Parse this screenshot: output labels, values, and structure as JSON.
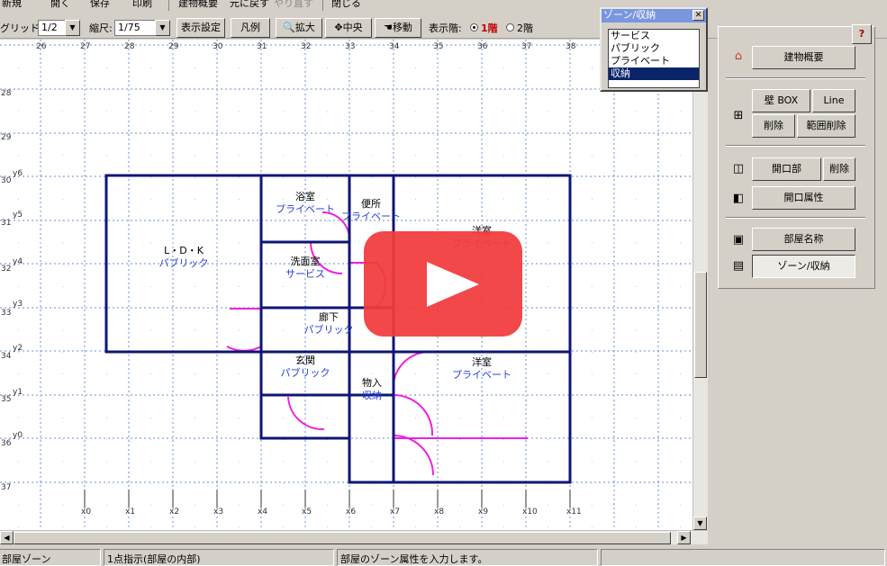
{
  "menu": [
    {
      "label": "新規",
      "disabled": false
    },
    {
      "label": "開く",
      "disabled": false
    },
    {
      "label": "保存",
      "disabled": false
    },
    {
      "label": "印刷",
      "disabled": false
    },
    {
      "label": "建物概要",
      "disabled": false
    },
    {
      "label": "元に戻す",
      "disabled": false
    },
    {
      "label": "やり直す",
      "disabled": true
    },
    {
      "label": "閉じる",
      "disabled": false
    }
  ],
  "toolbar": {
    "grid_label": "グリッド:",
    "grid_value": "1/2",
    "scale_label": "縮尺:",
    "scale_value": "1/75",
    "display_settings": "表示設定",
    "legend": "凡例",
    "zoom": "拡大",
    "center": "中央",
    "move": "移動",
    "floor_label": "表示階:",
    "floor1": "1階",
    "floor2": "2階",
    "floor_selected": "1階"
  },
  "zone_window": {
    "title": "ゾーン/収納",
    "close": "✕",
    "options": [
      "サービス",
      "パブリック",
      "プライベート",
      "収納"
    ],
    "selected": "収納"
  },
  "right_panel": {
    "help": "?",
    "building_overview": "建物概要",
    "wall_box": "壁 BOX",
    "line": "Line",
    "delete": "削除",
    "range_delete": "範囲削除",
    "opening": "開口部",
    "opening_delete": "削除",
    "opening_attr": "開口属性",
    "room_name": "部屋名称",
    "zone_storage": "ゾーン/収納"
  },
  "plan": {
    "top_axis": [
      "26",
      "27",
      "28",
      "29",
      "30",
      "31",
      "32",
      "33",
      "34",
      "35",
      "36",
      "37",
      "38"
    ],
    "left_axis": [
      "28",
      "29",
      "y6",
      "30",
      "y5",
      "31",
      "y4",
      "32",
      "y3",
      "33",
      "y2",
      "34",
      "y1",
      "35",
      "y0",
      "36",
      "37"
    ],
    "bottom_axis": [
      "x0",
      "x1",
      "x2",
      "x3",
      "x4",
      "x5",
      "x6",
      "x7",
      "x8",
      "x9",
      "x10",
      "x11"
    ],
    "rooms": [
      {
        "name": "浴室",
        "zone": "プライベート"
      },
      {
        "name": "便所",
        "zone": "プライベート"
      },
      {
        "name": "洋室",
        "zone": "プライベート"
      },
      {
        "name": "L・D・K",
        "zone": "パブリック"
      },
      {
        "name": "洗面室",
        "zone": "サービス"
      },
      {
        "name": "廊下",
        "zone": "パブリック"
      },
      {
        "name": "玄関",
        "zone": "パブリック"
      },
      {
        "name": "物入",
        "zone": "収納"
      },
      {
        "name": "洋室",
        "zone": "プライベート"
      }
    ],
    "wall_color": "#0f1575",
    "opening_color": "#ee22dd",
    "zone_text_color": "#2b3fd6",
    "grid_color": "#6a8fd6"
  },
  "status": {
    "mode": "部屋ゾーン",
    "instruction": "1点指示(部屋の内部)",
    "message": "部屋のゾーン属性を入力します。"
  },
  "video_overlay": {
    "color": "#f23b3c",
    "icon": "play-icon"
  }
}
